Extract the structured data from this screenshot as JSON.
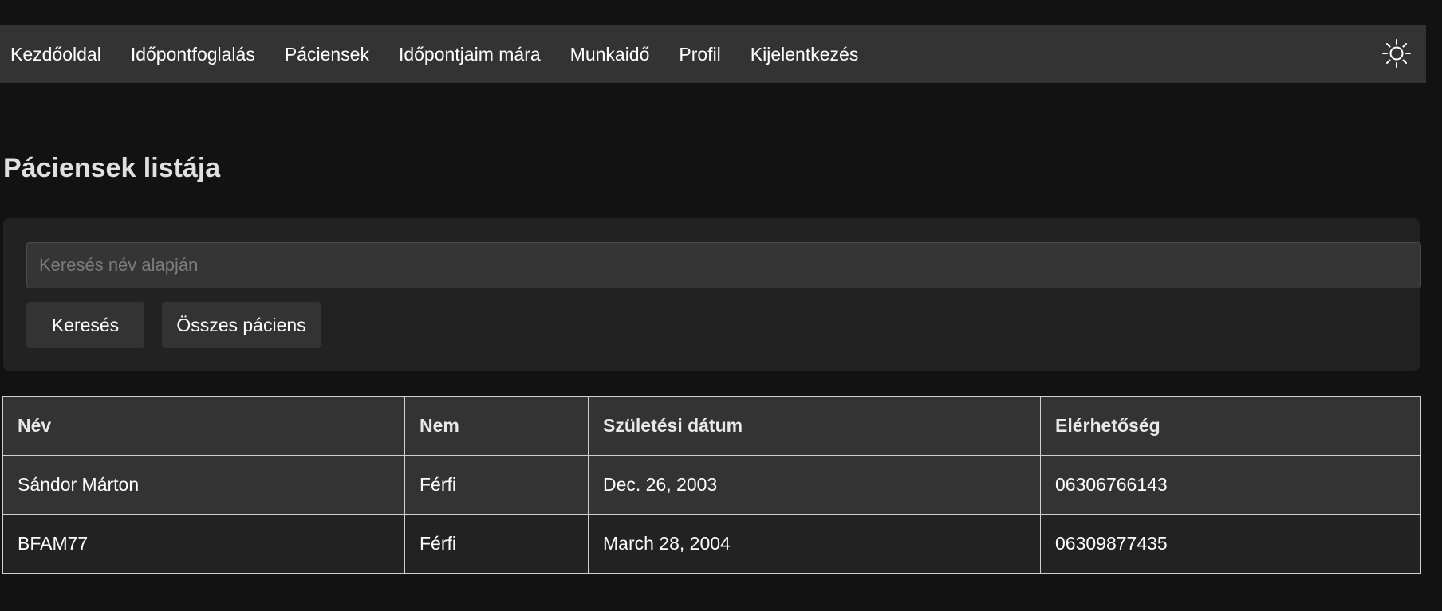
{
  "nav": {
    "items": [
      {
        "label": "Kezdőoldal"
      },
      {
        "label": "Időpontfoglalás"
      },
      {
        "label": "Páciensek"
      },
      {
        "label": "Időpontjaim mára"
      },
      {
        "label": "Munkaidő"
      },
      {
        "label": "Profil"
      },
      {
        "label": "Kijelentkezés"
      }
    ],
    "theme_icon": "sun-icon"
  },
  "page": {
    "title": "Páciensek listája"
  },
  "search": {
    "value": "",
    "placeholder": "Keresés név alapján",
    "search_button": "Keresés",
    "all_button": "Összes páciens"
  },
  "table": {
    "headers": [
      "Név",
      "Nem",
      "Születési dátum",
      "Elérhetőség"
    ],
    "rows": [
      [
        "Sándor Márton",
        "Férfi",
        "Dec. 26, 2003",
        "06306766143"
      ],
      [
        "BFAM77",
        "Férfi",
        "March 28, 2004",
        "06309877435"
      ]
    ]
  },
  "colors": {
    "background": "#121212",
    "navbar": "#333333",
    "card": "#222222"
  }
}
